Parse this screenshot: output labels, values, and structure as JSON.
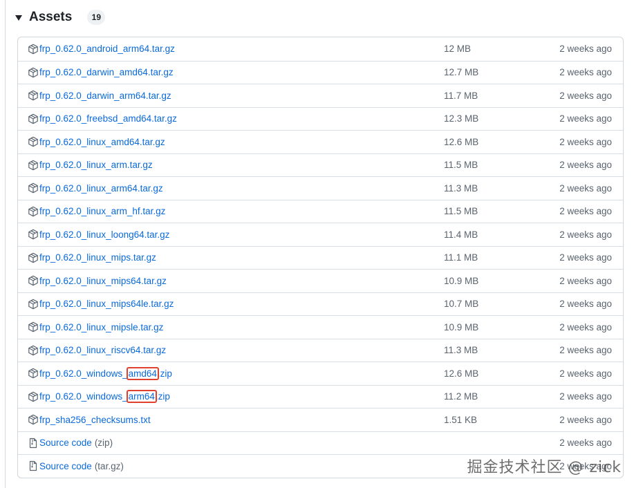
{
  "header": {
    "title": "Assets",
    "count": "19"
  },
  "assets": [
    {
      "icon": "package-icon",
      "name": "frp_0.62.0_android_arm64.tar.gz",
      "size": "12 MB",
      "date": "2 weeks ago"
    },
    {
      "icon": "package-icon",
      "name": "frp_0.62.0_darwin_amd64.tar.gz",
      "size": "12.7 MB",
      "date": "2 weeks ago"
    },
    {
      "icon": "package-icon",
      "name": "frp_0.62.0_darwin_arm64.tar.gz",
      "size": "11.7 MB",
      "date": "2 weeks ago"
    },
    {
      "icon": "package-icon",
      "name": "frp_0.62.0_freebsd_amd64.tar.gz",
      "size": "12.3 MB",
      "date": "2 weeks ago"
    },
    {
      "icon": "package-icon",
      "name": "frp_0.62.0_linux_amd64.tar.gz",
      "size": "12.6 MB",
      "date": "2 weeks ago"
    },
    {
      "icon": "package-icon",
      "name": "frp_0.62.0_linux_arm.tar.gz",
      "size": "11.5 MB",
      "date": "2 weeks ago"
    },
    {
      "icon": "package-icon",
      "name": "frp_0.62.0_linux_arm64.tar.gz",
      "size": "11.3 MB",
      "date": "2 weeks ago"
    },
    {
      "icon": "package-icon",
      "name": "frp_0.62.0_linux_arm_hf.tar.gz",
      "size": "11.5 MB",
      "date": "2 weeks ago"
    },
    {
      "icon": "package-icon",
      "name": "frp_0.62.0_linux_loong64.tar.gz",
      "size": "11.4 MB",
      "date": "2 weeks ago"
    },
    {
      "icon": "package-icon",
      "name": "frp_0.62.0_linux_mips.tar.gz",
      "size": "11.1 MB",
      "date": "2 weeks ago"
    },
    {
      "icon": "package-icon",
      "name": "frp_0.62.0_linux_mips64.tar.gz",
      "size": "10.9 MB",
      "date": "2 weeks ago"
    },
    {
      "icon": "package-icon",
      "name": "frp_0.62.0_linux_mips64le.tar.gz",
      "size": "10.7 MB",
      "date": "2 weeks ago"
    },
    {
      "icon": "package-icon",
      "name": "frp_0.62.0_linux_mipsle.tar.gz",
      "size": "10.9 MB",
      "date": "2 weeks ago"
    },
    {
      "icon": "package-icon",
      "name": "frp_0.62.0_linux_riscv64.tar.gz",
      "size": "11.3 MB",
      "date": "2 weeks ago"
    },
    {
      "icon": "package-icon",
      "name_pre": "frp_0.62.0_windows_",
      "name_hl": "amd64",
      "name_post": ".zip",
      "size": "12.6 MB",
      "date": "2 weeks ago"
    },
    {
      "icon": "package-icon",
      "name_pre": "frp_0.62.0_windows_",
      "name_hl": "arm64",
      "name_post": ".zip",
      "size": "11.2 MB",
      "date": "2 weeks ago"
    },
    {
      "icon": "package-icon",
      "name": "frp_sha256_checksums.txt",
      "size": "1.51 KB",
      "date": "2 weeks ago"
    },
    {
      "icon": "file-zip-icon",
      "name": "Source code",
      "suffix": "(zip)",
      "size": "",
      "date": "2 weeks ago"
    },
    {
      "icon": "file-zip-icon",
      "name": "Source code",
      "suffix": "(tar.gz)",
      "size": "",
      "date": "2 weeks ago"
    }
  ],
  "highlight_color": "#e0412f",
  "link_color": "#0969da",
  "watermark": "掘金技术社区 @ zick"
}
